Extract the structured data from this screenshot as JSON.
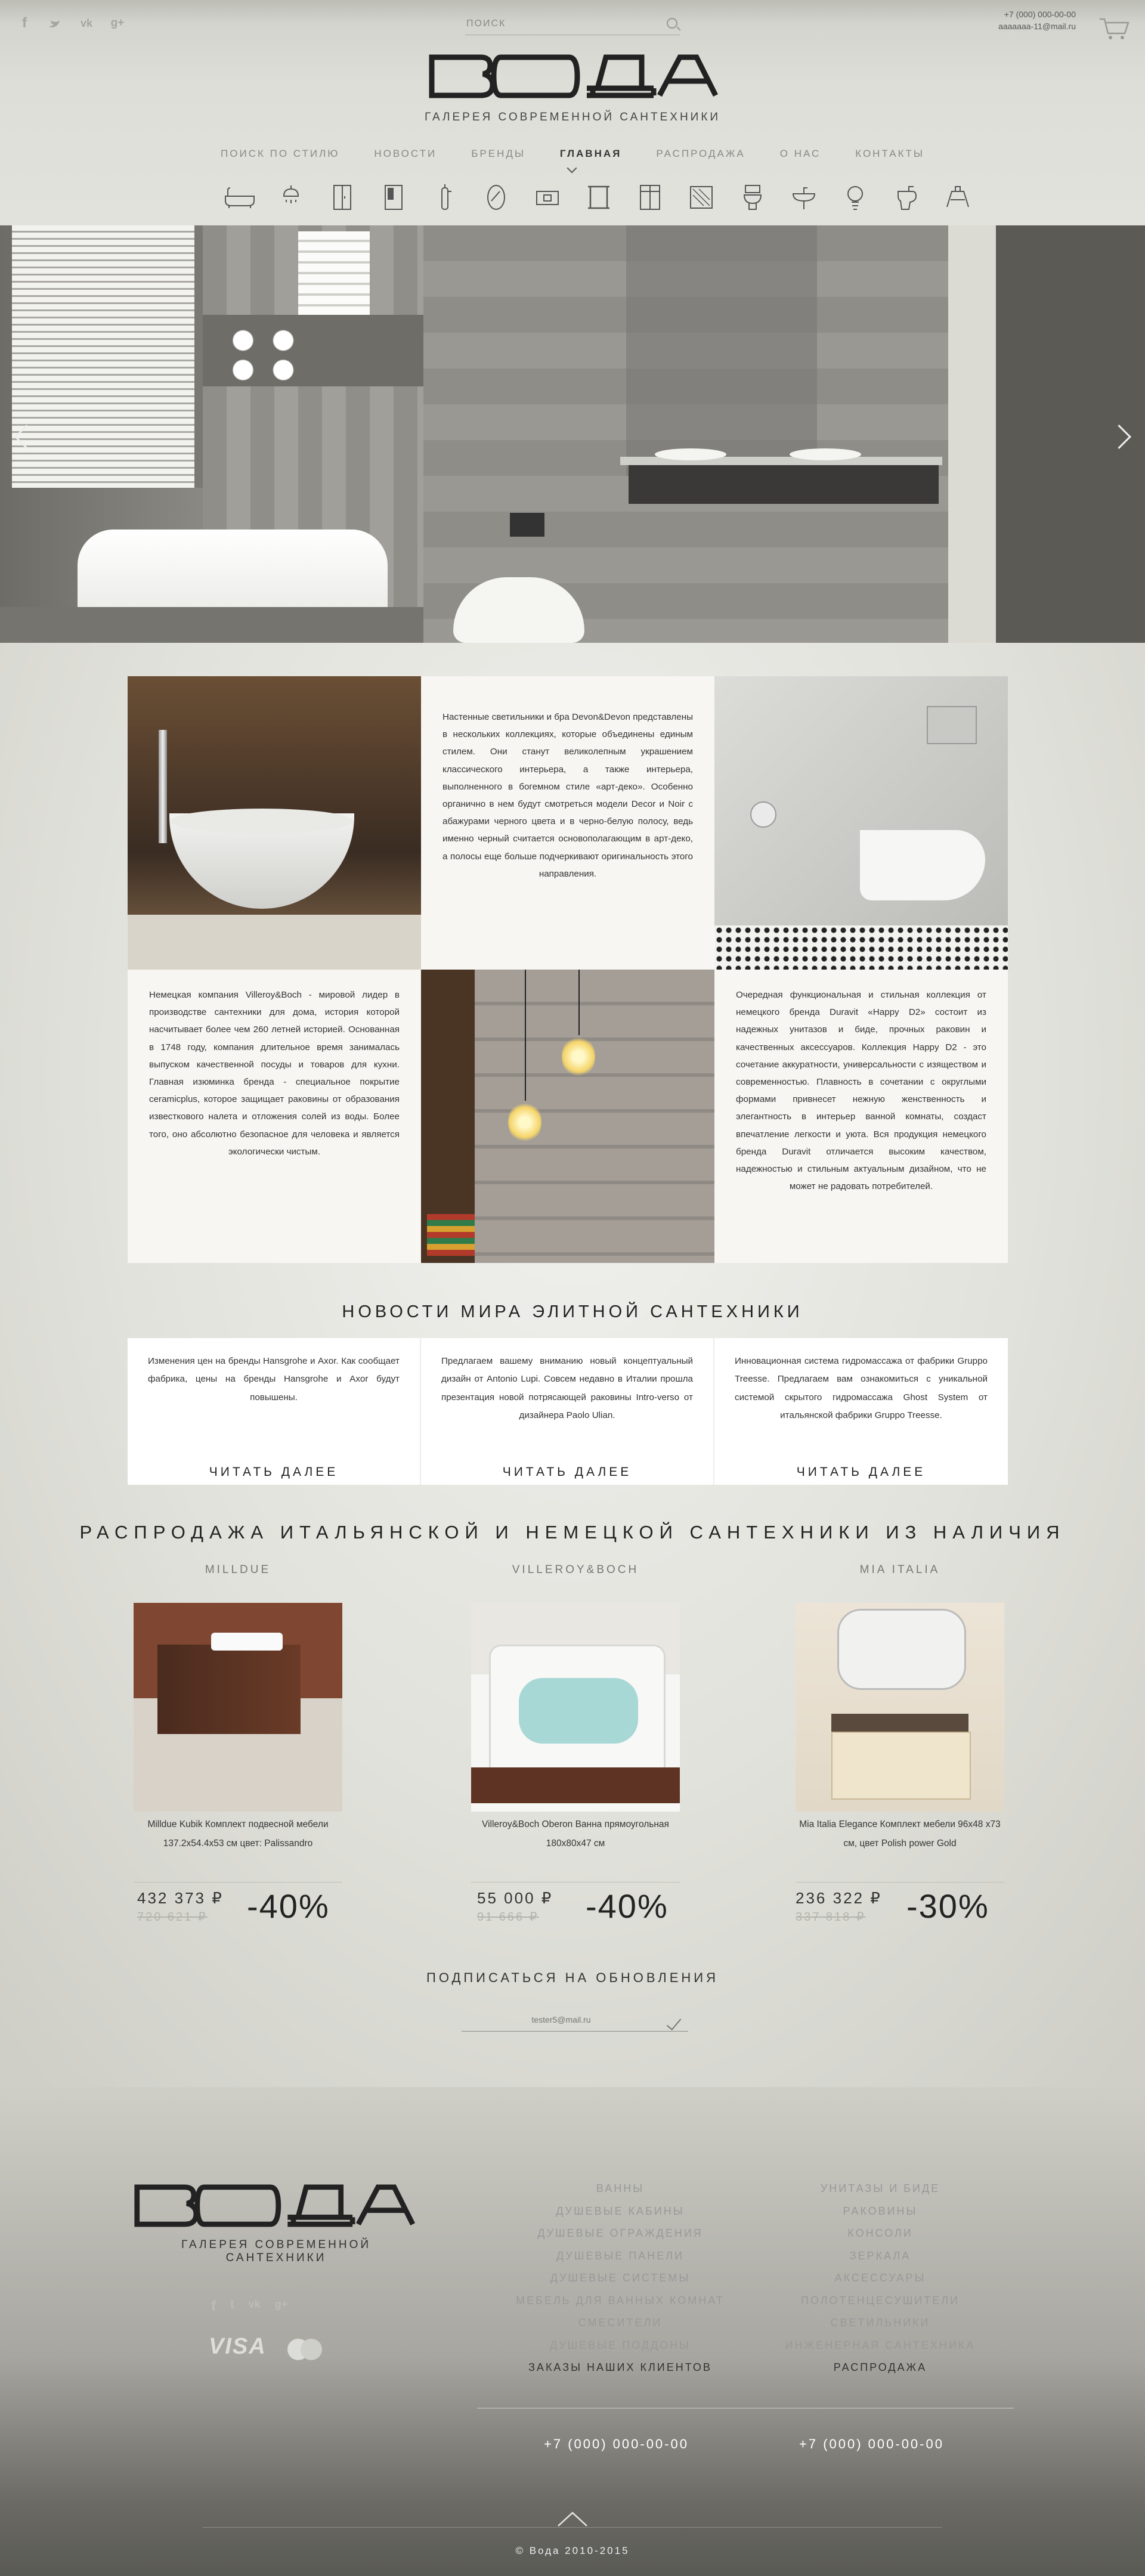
{
  "header": {
    "search_placeholder": "ПОИСК",
    "phone": "+7 (000) 000-00-00",
    "email": "aaaaaaa-11@mail.ru",
    "tagline": "ГАЛЕРЕЯ СОВРЕМЕННОЙ САНТЕХНИКИ",
    "nav": [
      {
        "label": "ПОИСК ПО СТИЛЮ"
      },
      {
        "label": "НОВОСТИ"
      },
      {
        "label": "БРЕНДЫ"
      },
      {
        "label": "ГЛАВНАЯ"
      },
      {
        "label": "РАСПРОДАЖА"
      },
      {
        "label": "О НАС"
      },
      {
        "label": "КОНТАКТЫ"
      }
    ],
    "social_icons": [
      "facebook-icon",
      "twitter-icon",
      "vk-icon",
      "google-plus-icon"
    ],
    "category_icons": [
      "bathtub-icon",
      "shower-icon",
      "shower-cabin-icon",
      "shower-partition-icon",
      "tap-icon",
      "mirror-icon",
      "shower-panel-icon",
      "bath-screen-icon",
      "furniture-icon",
      "shower-tray-icon",
      "toilet-icon",
      "washbasin-icon",
      "lamp-icon",
      "bidet-icon",
      "accessories-icon"
    ]
  },
  "intro": {
    "devon": "Настенные светильники и бра Devon&Devon представлены в нескольких коллекциях, которые объединены единым стилем. Они станут великолепным украшением классического интерьера, а также интерьера, выполненного в богемном стиле «арт-деко». Особенно органично в нем будут смотреться модели Decor и Noir с абажурами черного цвета и в черно-белую полосу, ведь именно черный считается основополагающим в арт-деко, а полосы еще больше подчеркивают оригинальность этого направления.",
    "villeroy": "Немецкая компания Villeroy&Boch - мировой лидер в производстве сантехники для дома, история которой насчитывает более чем 260 летней историей. Основанная в 1748 году, компания длительное время занималась выпуском качественной посуды и товаров для кухни. Главная изюминка бренда - специальное покрытие ceramicplus, которое защищает раковины от образования известкового налета и отложения солей из воды. Более того, оно абсолютно безопасное для человека и является экологически чистым.",
    "duravit": "Очередная функциональная и стильная коллекция от немецкого бренда Duravit «Happy D2» состоит из надежных унитазов и биде, прочных раковин и качественных аксессуаров. Коллекция Happy D2 - это сочетание аккуратности, универсальности с изяществом и современностью. Плавность в сочетании с округлыми формами привнесет нежную женственность и элегантность в интерьер ванной комнаты, создаст впечатление легкости и уюта. Вся продукция немецкого бренда Duravit отличается высоким качеством, надежностью и стильным актуальным дизайном, что не может не радовать потребителей."
  },
  "news": {
    "title": "НОВОСТИ МИРА ЭЛИТНОЙ САНТЕХНИКИ",
    "items": [
      {
        "text": "Изменения цен на бренды Hansgrohe и Axor. Как сообщает фабрика, цены на бренды Hansgrohe и Axor будут повышены.",
        "link": "ЧИТАТЬ ДАЛЕЕ"
      },
      {
        "text": "Предлагаем вашему вниманию новый концептуальный дизайн от Antonio Lupi. Совсем недавно в Италии прошла презентация новой потрясающей раковины Intro-verso от дизайнера Paolo Ulian.",
        "link": "ЧИТАТЬ ДАЛЕЕ"
      },
      {
        "text": "Инновационная система гидромассажа от фабрики Gruppo Treesse. Предлагаем вам ознакомиться с уникальной системой скрытого гидромассажа Ghost System от итальянской фабрики Gruppo Treesse.",
        "link": "ЧИТАТЬ ДАЛЕЕ"
      }
    ]
  },
  "sale": {
    "title": "РАСПРОДАЖА ИТАЛЬЯНСКОЙ И НЕМЕЦКОЙ САНТЕХНИКИ ИЗ НАЛИЧИЯ",
    "products": [
      {
        "brand": "MILLDUE",
        "name": "Milldue Kubik Комплект подвесной мебели 137.2x54.4x53 см цвет: Palissandro",
        "price": "432 373 ₽",
        "old_price": "720 621 ₽",
        "discount": "-40%"
      },
      {
        "brand": "VILLEROY&BOCH",
        "name": "Villeroy&Boch Oberon Ванна прямоугольная 180x80x47 см",
        "price": "55 000 ₽",
        "old_price": "91 666 ₽",
        "discount": "-40%"
      },
      {
        "brand": "MIA ITALIA",
        "name": "Mia Italia Elegance Комплект мебели 96x48 x73 см, цвет Polish power Gold",
        "price": "236 322 ₽",
        "old_price": "337 818 ₽",
        "discount": "-30%"
      }
    ]
  },
  "subscribe": {
    "title": "ПОДПИСАТЬСЯ НА ОБНОВЛЕНИЯ",
    "placeholder": "tester5@mail.ru"
  },
  "footer": {
    "tagline": "ГАЛЕРЕЯ СОВРЕМЕННОЙ САНТЕХНИКИ",
    "col1": [
      "ВАННЫ",
      "ДУШЕВЫЕ КАБИНЫ",
      "ДУШЕВЫЕ ОГРАЖДЕНИЯ",
      "ДУШЕВЫЕ ПАНЕЛИ",
      "ДУШЕВЫЕ СИСТЕМЫ",
      "МЕБЕЛЬ ДЛЯ ВАННЫХ КОМНАТ",
      "СМЕСИТЕЛИ",
      "ДУШЕВЫЕ ПОДДОНЫ",
      "ЗАКАЗЫ НАШИХ КЛИЕНТОВ"
    ],
    "col2": [
      "УНИТАЗЫ И БИДЕ",
      "РАКОВИНЫ",
      "КОНСОЛИ",
      "ЗЕРКАЛА",
      "АКСЕССУАРЫ",
      "ПОЛОТЕНЦЕСУШИТЕЛИ",
      "СВЕТИЛЬНИКИ",
      "ИНЖЕНЕРНАЯ САНТЕХНИКА",
      "РАСПРОДАЖА"
    ],
    "phone1": "+7 (000) 000-00-00",
    "phone2": "+7 (000) 000-00-00",
    "visa": "VISA",
    "copyright": "© Вода 2010-2015"
  },
  "colors": {
    "text": "#333333",
    "muted": "#999999",
    "tile": "#f7f6f2",
    "footer_dark": "#5a5a55"
  }
}
